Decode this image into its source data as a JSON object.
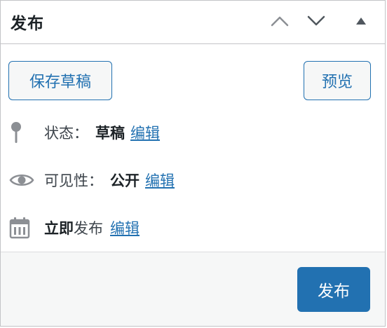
{
  "header": {
    "title": "发布",
    "move_up_icon": "chevron-up-icon",
    "move_down_icon": "chevron-down-icon",
    "toggle_icon": "triangle-up-icon"
  },
  "actions": {
    "save_draft_label": "保存草稿",
    "preview_label": "预览"
  },
  "status": {
    "icon": "pin-icon",
    "label": "状态：",
    "value": "草稿",
    "edit_label": "编辑"
  },
  "visibility": {
    "icon": "eye-icon",
    "label": "可见性：",
    "value": "公开",
    "edit_label": "编辑"
  },
  "schedule": {
    "icon": "calendar-icon",
    "value": "立即",
    "label": "发布",
    "edit_label": "编辑"
  },
  "footer": {
    "publish_label": "发布"
  },
  "colors": {
    "accent": "#2271b1",
    "border": "#c3c4c7",
    "footer_bg": "#f6f7f7"
  }
}
